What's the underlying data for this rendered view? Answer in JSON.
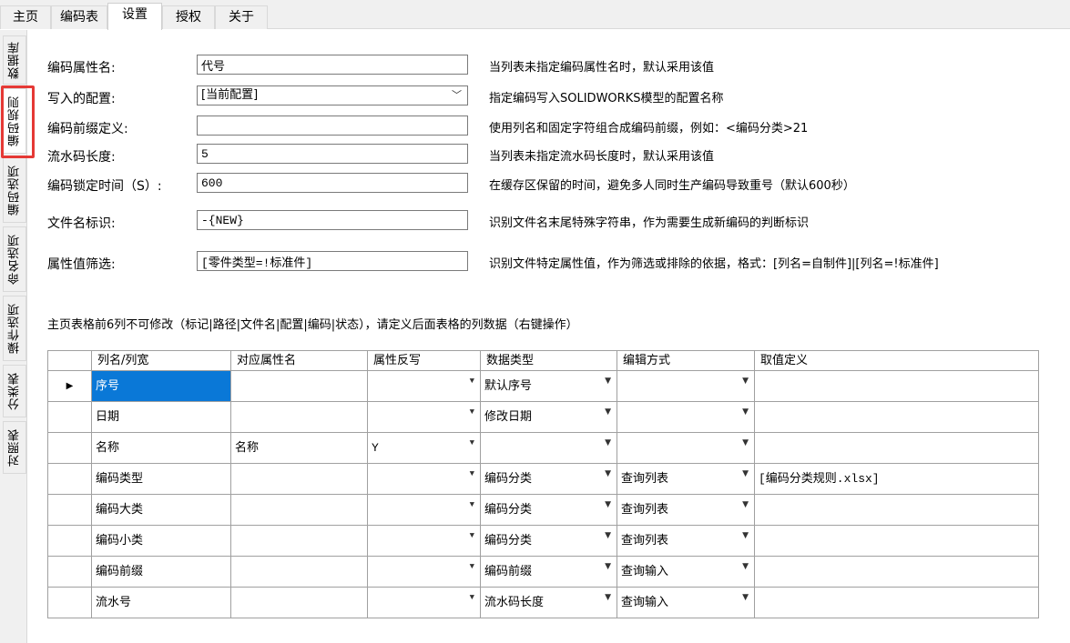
{
  "top_tabs": [
    "主页",
    "编码表",
    "设置",
    "授权",
    "关于"
  ],
  "side_tabs": [
    "数据库",
    "编码规则",
    "编码选项",
    "命名选项",
    "操作选项",
    "分类表",
    "对照表"
  ],
  "form": {
    "prop_name": {
      "label": "编码属性名:",
      "value": "代号",
      "desc": "当列表未指定编码属性名时，默认采用该值"
    },
    "config": {
      "label": "写入的配置:",
      "value": "[当前配置]",
      "desc": "指定编码写入SOLIDWORKS模型的配置名称"
    },
    "prefix": {
      "label": "编码前缀定义:",
      "value": "",
      "desc": "使用列名和固定字符组合成编码前缀，例如：<编码分类>21"
    },
    "serial_len": {
      "label": "流水码长度:",
      "value": "5",
      "desc": "当列表未指定流水码长度时，默认采用该值"
    },
    "lock_time": {
      "label": "编码锁定时间（S）:",
      "value": "600",
      "desc": "在缓存区保留的时间，避免多人同时生产编码导致重号（默认600秒）"
    },
    "file_mark": {
      "label": "文件名标识:",
      "value": "-{NEW}",
      "desc": "识别文件名末尾特殊字符串，作为需要生成新编码的判断标识"
    },
    "filter": {
      "label": "属性值筛选:",
      "value": "[零件类型=!标准件]",
      "desc": "识别文件特定属性值，作为筛选或排除的依据，格式：[列名=自制件]|[列名=!标准件]"
    }
  },
  "note": "主页表格前6列不可修改（标记|路径|文件名|配置|编码|状态），请定义后面表格的列数据（右键操作）",
  "grid": {
    "headers": [
      "列名/列宽",
      "对应属性名",
      "属性反写",
      "数据类型",
      "编辑方式",
      "取值定义"
    ],
    "rows": [
      [
        "序号",
        "",
        "",
        "默认序号",
        "",
        ""
      ],
      [
        "日期",
        "",
        "",
        "修改日期",
        "",
        ""
      ],
      [
        "名称",
        "名称",
        "Y",
        "",
        "",
        ""
      ],
      [
        "编码类型",
        "",
        "",
        "编码分类",
        "查询列表",
        "[编码分类规则.xlsx]"
      ],
      [
        "编码大类",
        "",
        "",
        "编码分类",
        "查询列表",
        ""
      ],
      [
        "编码小类",
        "",
        "",
        "编码分类",
        "查询列表",
        ""
      ],
      [
        "编码前缀",
        "",
        "",
        "编码前缀",
        "查询输入",
        ""
      ],
      [
        "流水号",
        "",
        "",
        "流水码长度",
        "查询输入",
        ""
      ]
    ]
  },
  "icons": {
    "row_indicator": "triangle-right",
    "dropdown": "triangle-down",
    "select_chevron": "chevron-down"
  },
  "colors": {
    "selected_cell": "#0a78d7",
    "highlight_box": "#e53935"
  }
}
